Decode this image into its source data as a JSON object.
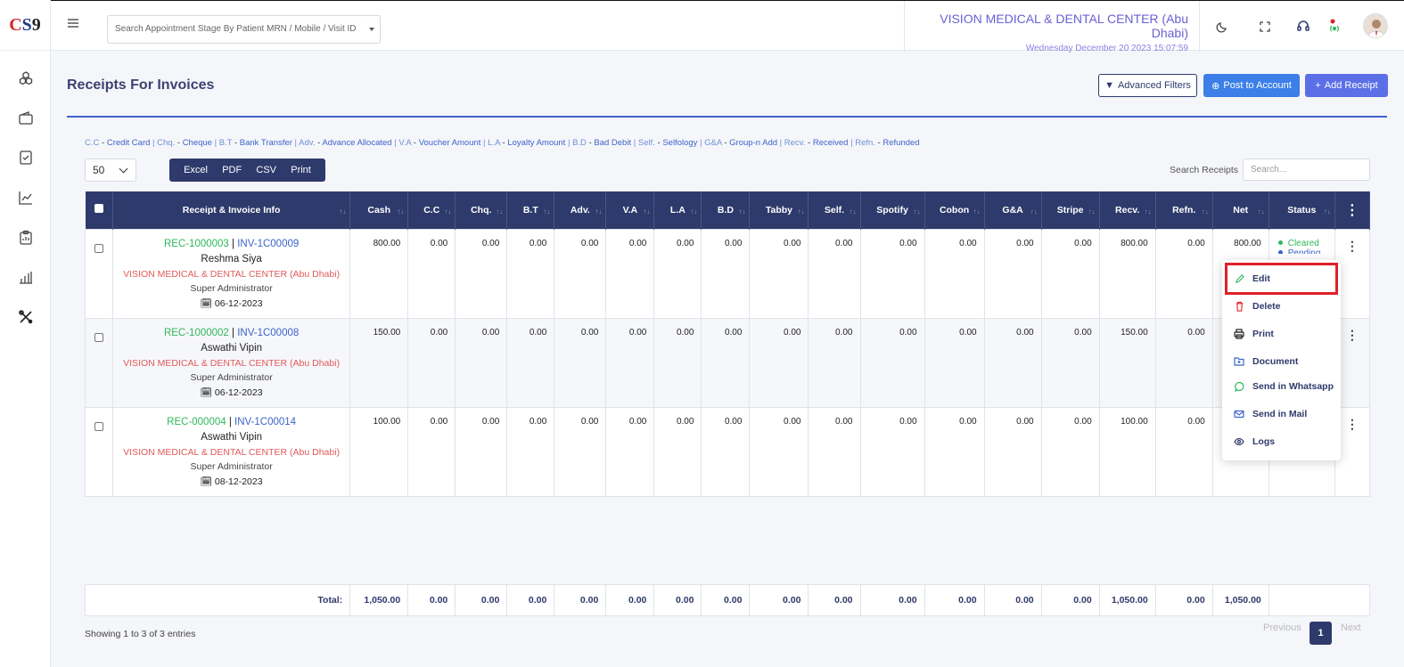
{
  "app": {
    "logo": {
      "c": "C",
      "s": "S",
      "n": "9"
    }
  },
  "header": {
    "search_placeholder": "Search Appointment Stage By Patient MRN / Mobile / Visit ID",
    "clinic_name": "VISION MEDICAL & DENTAL CENTER (Abu Dhabi)",
    "datetime": "Wednesday December 20 2023 15:07:59"
  },
  "page": {
    "title": "Receipts For Invoices",
    "buttons": {
      "advanced_filters": "Advanced Filters",
      "post_to_account": "Post to Account",
      "add_receipt": "Add Receipt"
    },
    "legend": [
      {
        "a": "C.C",
        "b": "Credit Card"
      },
      {
        "a": "Chq.",
        "b": "Cheque"
      },
      {
        "a": "B.T",
        "b": "Bank Transfer"
      },
      {
        "a": "Adv.",
        "b": "Advance Allocated"
      },
      {
        "a": "V.A",
        "b": "Voucher Amount"
      },
      {
        "a": "L.A",
        "b": "Loyalty Amount"
      },
      {
        "a": "B.D",
        "b": "Bad Debit"
      },
      {
        "a": "Self.",
        "b": "Selfology"
      },
      {
        "a": "G&A",
        "b": "Group-n Add"
      },
      {
        "a": "Recv.",
        "b": "Received"
      },
      {
        "a": "Refn.",
        "b": "Refunded"
      }
    ],
    "page_length": "50",
    "export": {
      "excel": "Excel",
      "pdf": "PDF",
      "csv": "CSV",
      "print": "Print"
    },
    "search_label": "Search Receipts",
    "search_placeholder": "Search..."
  },
  "table": {
    "headers": [
      "Receipt & Invoice Info",
      "Cash",
      "C.C",
      "Chq.",
      "B.T",
      "Adv.",
      "V.A",
      "L.A",
      "B.D",
      "Tabby",
      "Self.",
      "Spotify",
      "Cobon",
      "G&A",
      "Stripe",
      "Recv.",
      "Refn.",
      "Net",
      "Status"
    ],
    "rows": [
      {
        "rec": "REC-1000003",
        "inv": "INV-1C00009",
        "patient": "Reshma Siya",
        "clinic": "VISION MEDICAL & DENTAL CENTER (Abu Dhabi)",
        "user": "Super Administrator",
        "date": "06-12-2023",
        "amounts": [
          "800.00",
          "0.00",
          "0.00",
          "0.00",
          "0.00",
          "0.00",
          "0.00",
          "0.00",
          "0.00",
          "0.00",
          "0.00",
          "0.00",
          "0.00",
          "0.00",
          "800.00",
          "0.00",
          "800.00"
        ],
        "status": [
          {
            "label": "Cleared",
            "color": "#2eb85c"
          },
          {
            "label": "Pending",
            "color": "#3d63c9"
          }
        ]
      },
      {
        "rec": "REC-1000002",
        "inv": "INV-1C00008",
        "patient": "Aswathi Vipin",
        "clinic": "VISION MEDICAL & DENTAL CENTER (Abu Dhabi)",
        "user": "Super Administrator",
        "date": "06-12-2023",
        "amounts": [
          "150.00",
          "0.00",
          "0.00",
          "0.00",
          "0.00",
          "0.00",
          "0.00",
          "0.00",
          "0.00",
          "0.00",
          "0.00",
          "0.00",
          "0.00",
          "0.00",
          "150.00",
          "0.00",
          ""
        ],
        "status": []
      },
      {
        "rec": "REC-000004",
        "inv": "INV-1C00014",
        "patient": "Aswathi Vipin",
        "clinic": "VISION MEDICAL & DENTAL CENTER (Abu Dhabi)",
        "user": "Super Administrator",
        "date": "08-12-2023",
        "amounts": [
          "100.00",
          "0.00",
          "0.00",
          "0.00",
          "0.00",
          "0.00",
          "0.00",
          "0.00",
          "0.00",
          "0.00",
          "0.00",
          "0.00",
          "0.00",
          "0.00",
          "100.00",
          "0.00",
          ""
        ],
        "status": []
      }
    ],
    "totals": {
      "label": "Total:",
      "values": [
        "1,050.00",
        "0.00",
        "0.00",
        "0.00",
        "0.00",
        "0.00",
        "0.00",
        "0.00",
        "0.00",
        "0.00",
        "0.00",
        "0.00",
        "0.00",
        "0.00",
        "1,050.00",
        "0.00",
        "1,050.00"
      ]
    }
  },
  "pagination": {
    "info": "Showing 1 to 3 of 3 entries",
    "previous": "Previous",
    "current": "1",
    "next": "Next"
  },
  "action_menu": {
    "items": [
      {
        "label": "Edit",
        "icon": "pencil-icon"
      },
      {
        "label": "Delete",
        "icon": "trash-icon"
      },
      {
        "label": "Print",
        "icon": "printer-icon"
      },
      {
        "label": "Document",
        "icon": "document-icon"
      },
      {
        "label": "Send in Whatsapp",
        "icon": "whatsapp-icon"
      },
      {
        "label": "Send in Mail",
        "icon": "mail-icon"
      },
      {
        "label": "Logs",
        "icon": "eye-icon"
      }
    ]
  }
}
